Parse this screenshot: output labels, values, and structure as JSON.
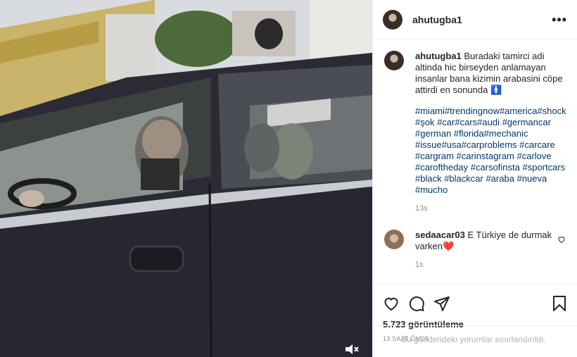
{
  "post": {
    "username": "ahutugba1",
    "more_icon": "more-dots-icon"
  },
  "caption": {
    "username": "ahutugba1",
    "text": "Buradaki tamirci adi altinda hic birseyden anlamayan insanlar bana kizimin arabasini cöpe attirdi en sonunda",
    "emoji": "🚺",
    "hashtags": "#miami#trendingnow#america#shock #şok #car#cars#audi #germancar #german #florida#mechanic #issue#usa#carproblems #carcare #cargram #carinstagram #carlove #caroftheday #carsofinsta #sportcars #black #blackcar #araba #nueva #mucho",
    "time": "13s"
  },
  "comment": {
    "username": "sedaacar03",
    "text": "E Türkiye de durmak varken",
    "emoji": "❤️",
    "time": "1s"
  },
  "actions": {
    "views": "5.723 görüntüleme",
    "ago": "13 SAAT ÖNCE",
    "add_comment_placeholder": "Bu gönderideki yorumlar sınırlandırıldı."
  },
  "colors": {
    "hashtag": "#00376b",
    "muted": "#8e8e8e",
    "heart": "#ed4956"
  }
}
